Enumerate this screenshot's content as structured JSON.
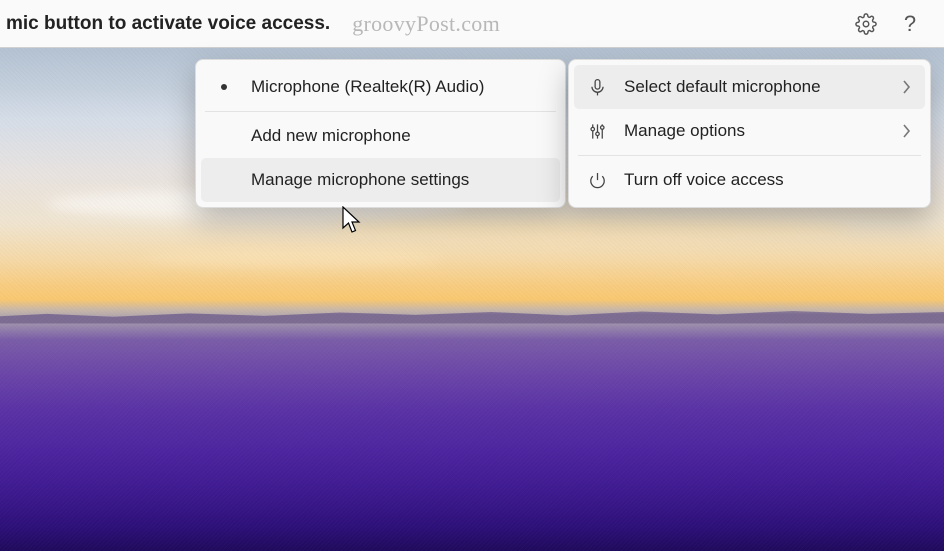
{
  "topbar": {
    "instruction": "mic button to activate voice access.",
    "watermark": "groovyPost.com",
    "settings_icon": "gear-icon",
    "help_label": "?"
  },
  "primary_menu": {
    "items": [
      {
        "label": "Select default microphone",
        "icon": "microphone-icon",
        "has_submenu": true,
        "highlighted": true
      },
      {
        "label": "Manage options",
        "icon": "sliders-icon",
        "has_submenu": true,
        "highlighted": false
      },
      {
        "label": "Turn off voice access",
        "icon": "power-icon",
        "has_submenu": false,
        "highlighted": false
      }
    ]
  },
  "secondary_menu": {
    "items": [
      {
        "label": "Microphone (Realtek(R) Audio)",
        "selected": true
      },
      {
        "label": "Add new microphone",
        "selected": false
      },
      {
        "label": "Manage microphone settings",
        "selected": false
      }
    ]
  }
}
